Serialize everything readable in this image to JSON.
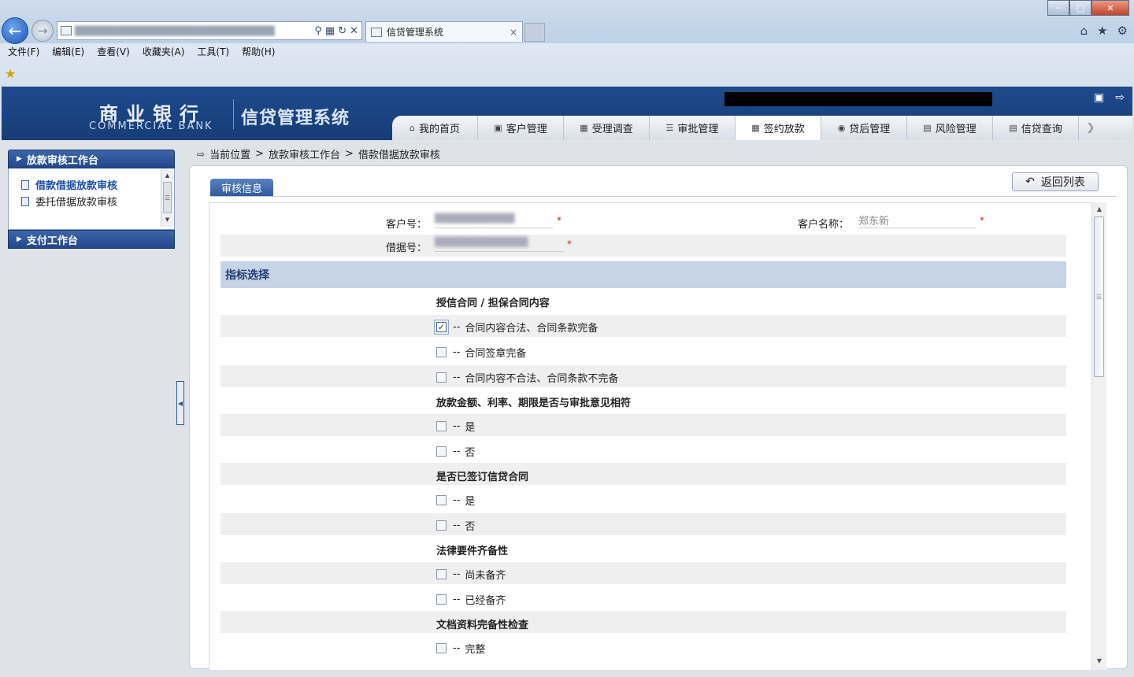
{
  "browser": {
    "tab_title": "信贷管理系统",
    "tab_close": "×",
    "menu": [
      "文件(F)",
      "编辑(E)",
      "查看(V)",
      "收藏夹(A)",
      "工具(T)",
      "帮助(H)"
    ]
  },
  "app": {
    "bank_cn": "商业银行",
    "bank_en": "COMMERCIAL BANK",
    "system_name": "信贷管理系统",
    "nav_tabs": [
      "我的首页",
      "客户管理",
      "受理调查",
      "审批管理",
      "签约放款",
      "贷后管理",
      "风险管理",
      "信贷查询"
    ],
    "active_tab": "签约放款"
  },
  "sidebar": {
    "section1": "放款审核工作台",
    "items": [
      "借款借据放款审核",
      "委托借据放款审核"
    ],
    "section2": "支付工作台"
  },
  "breadcrumb": {
    "root": "当前位置",
    "sep": ">",
    "level1": "放款审核工作台",
    "level2": "借款借据放款审核"
  },
  "main": {
    "section_tab": "审核信息",
    "return_button": "返回列表",
    "customer_no_label": "客户号：",
    "customer_name_label": "客户名称：",
    "customer_name_value": "郑东新",
    "loan_no_label": "借据号：",
    "required_mark": "*",
    "index_header": "指标选择",
    "dash": "--",
    "groups": [
      {
        "title": "授信合同 / 担保合同内容",
        "options": [
          {
            "label": "合同内容合法、合同条款完备",
            "checked": true
          },
          {
            "label": "合同签章完备",
            "checked": false
          },
          {
            "label": "合同内容不合法、合同条款不完备",
            "checked": false
          }
        ]
      },
      {
        "title": "放款金额、利率、期限是否与审批意见相符",
        "options": [
          {
            "label": "是",
            "checked": false
          },
          {
            "label": "否",
            "checked": false
          }
        ]
      },
      {
        "title": "是否已签订信贷合同",
        "options": [
          {
            "label": "是",
            "checked": false
          },
          {
            "label": "否",
            "checked": false
          }
        ]
      },
      {
        "title": "法律要件齐备性",
        "options": [
          {
            "label": "尚未备齐",
            "checked": false
          },
          {
            "label": "已经备齐",
            "checked": false
          }
        ]
      },
      {
        "title": "文档资料完备性检查",
        "options": [
          {
            "label": "完整",
            "checked": false
          }
        ]
      }
    ]
  },
  "icons": {
    "back": "arrow-left-icon",
    "forward": "arrow-right-icon",
    "search": "search-icon",
    "refresh": "refresh-icon",
    "home": "home-icon",
    "star": "star-icon",
    "gear": "gear-icon",
    "monitor": "monitor-icon",
    "logout": "logout-icon"
  },
  "colors": {
    "header_blue": "#1f4a8c",
    "section_header_bg": "#c7d3e6",
    "required_red": "#d32020"
  }
}
